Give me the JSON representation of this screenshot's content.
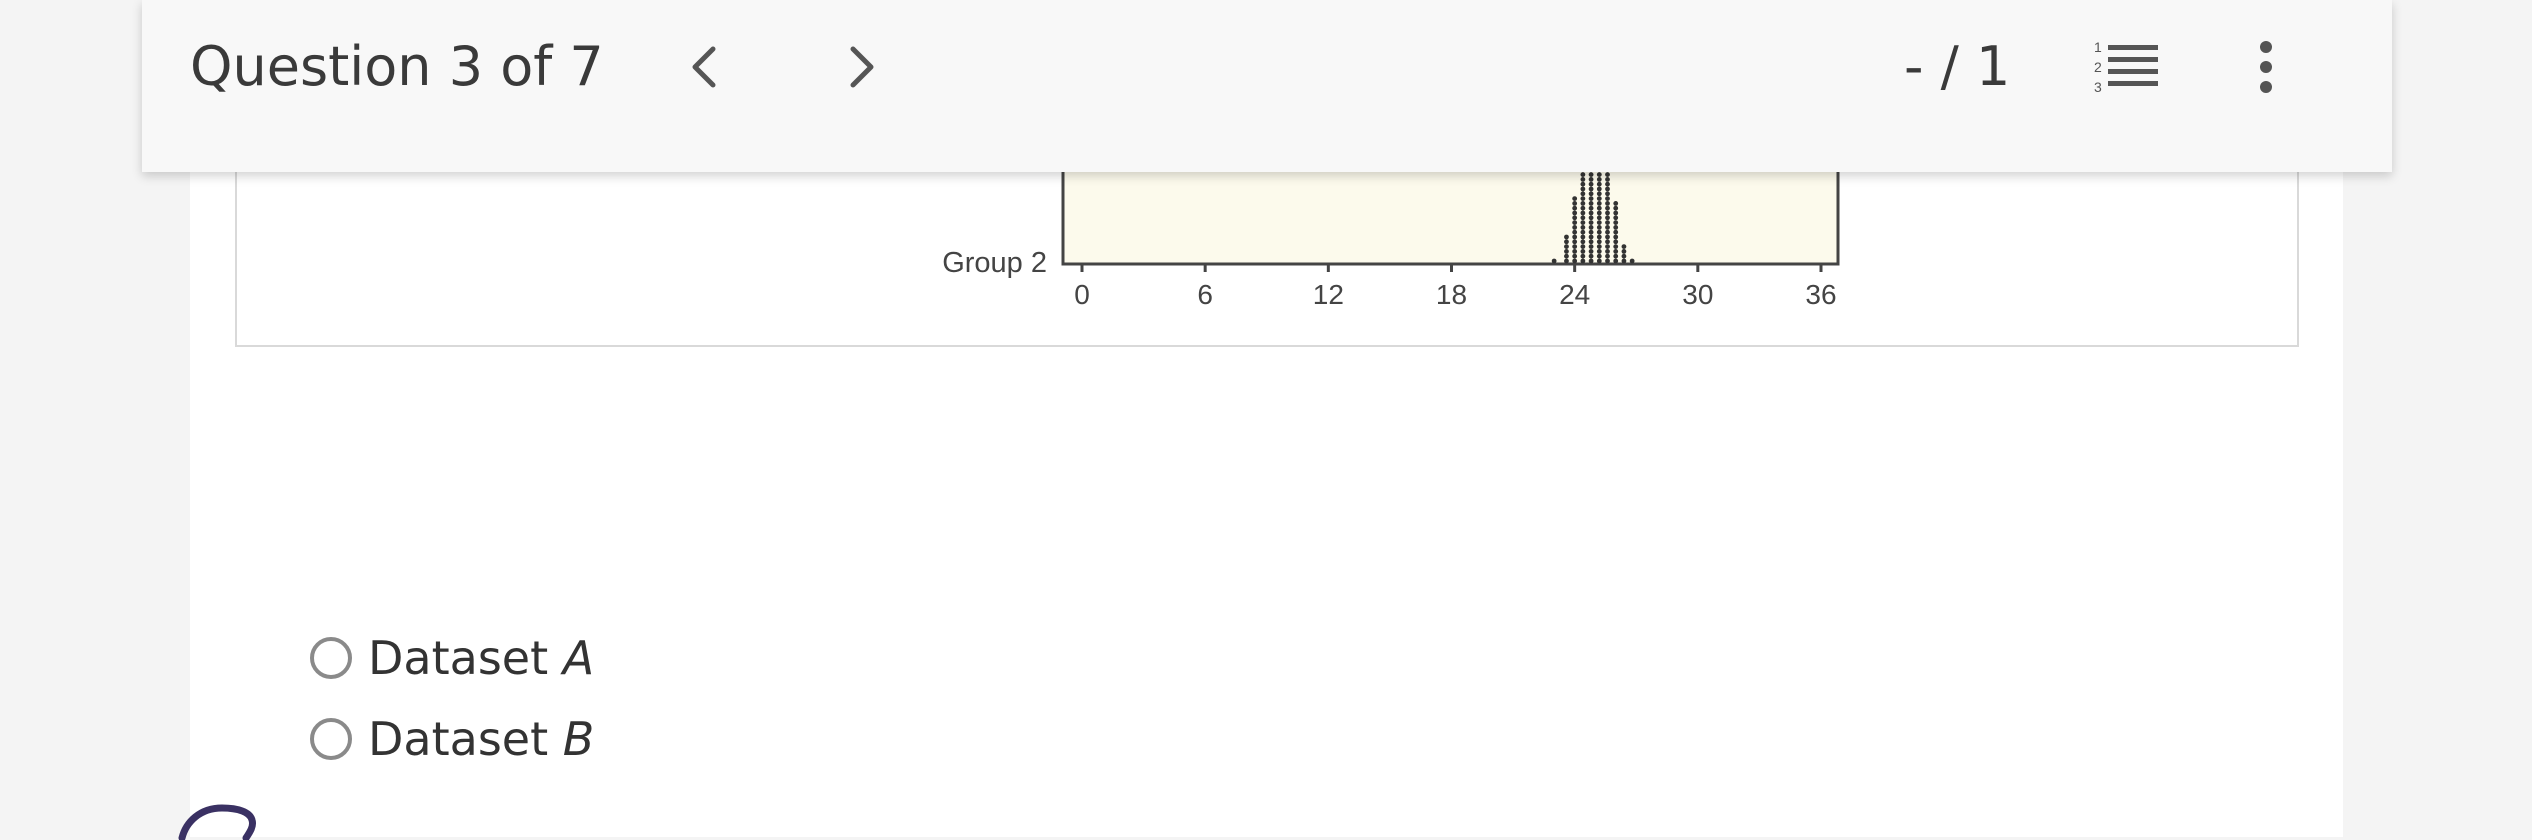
{
  "header": {
    "question_title": "Question 3 of 7",
    "score": "- / 1",
    "icons": {
      "prev": "chevron-left-icon",
      "next": "chevron-right-icon",
      "list": "numbered-list-icon",
      "more": "more-vertical-icon"
    }
  },
  "chart_data": {
    "type": "scatter",
    "group_label": "Group 2",
    "x_ticks": [
      "0",
      "6",
      "12",
      "18",
      "24",
      "30",
      "36"
    ],
    "xlim": [
      0,
      36
    ],
    "plot_background": "#fcfaec",
    "dot_color": "#333333",
    "columns": [
      {
        "x": 23.0,
        "count": 1
      },
      {
        "x": 23.6,
        "count": 6
      },
      {
        "x": 24.0,
        "count": 14
      },
      {
        "x": 24.4,
        "count": 20
      },
      {
        "x": 24.8,
        "count": 22
      },
      {
        "x": 25.2,
        "count": 22
      },
      {
        "x": 25.6,
        "count": 20
      },
      {
        "x": 26.0,
        "count": 13
      },
      {
        "x": 26.4,
        "count": 4
      },
      {
        "x": 26.8,
        "count": 1
      }
    ]
  },
  "options": [
    {
      "prefix": "Dataset ",
      "var": "A"
    },
    {
      "prefix": "Dataset ",
      "var": "B"
    }
  ]
}
